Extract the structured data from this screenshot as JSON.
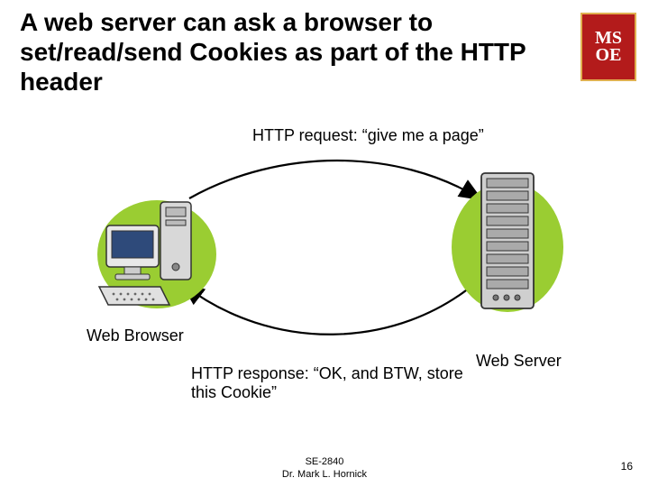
{
  "title": "A web server can ask a browser to set/read/send Cookies as part of the HTTP header",
  "logo": {
    "line1": "MS",
    "line2": "OE"
  },
  "diagram": {
    "request_label": "HTTP request: “give me a page”",
    "response_label": "HTTP response: “OK, and BTW, store this Cookie”",
    "client_label": "Web Browser",
    "server_label": "Web Server"
  },
  "footer": {
    "course": "SE-2840",
    "author": "Dr. Mark L. Hornick",
    "page": "16"
  }
}
